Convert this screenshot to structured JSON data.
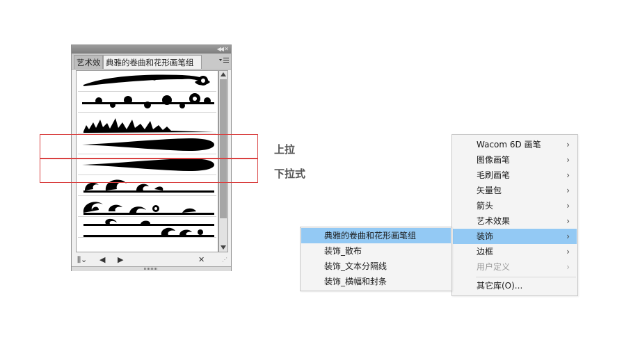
{
  "panel": {
    "tabs": [
      {
        "label": "艺术效"
      },
      {
        "label": "典雅的卷曲和花形画笔组"
      }
    ],
    "collapse_icon": "double-chevron-left-icon",
    "close_icon": "close-icon",
    "menu_icon": "panel-menu-icon",
    "brushes": [
      {
        "name": "curl-brush-1"
      },
      {
        "name": "curl-brush-2"
      },
      {
        "name": "flame-brush"
      },
      {
        "name": "taper-up-brush"
      },
      {
        "name": "taper-down-brush"
      },
      {
        "name": "wave-brush-1"
      },
      {
        "name": "wave-brush-2"
      },
      {
        "name": "wave-brush-3"
      }
    ],
    "bottom_icons": [
      "libraries-menu-icon",
      "previous-icon",
      "next-icon",
      "remove-brush-icon"
    ]
  },
  "callouts": {
    "upper": "上拉",
    "lower": "下拉式"
  },
  "main_menu": {
    "items": [
      {
        "label": "Wacom 6D 画笔",
        "has_submenu": true
      },
      {
        "label": "图像画笔",
        "has_submenu": true
      },
      {
        "label": "毛刷画笔",
        "has_submenu": true
      },
      {
        "label": "矢量包",
        "has_submenu": true
      },
      {
        "label": "箭头",
        "has_submenu": true
      },
      {
        "label": "艺术效果",
        "has_submenu": true
      },
      {
        "label": "装饰",
        "has_submenu": true,
        "highlighted": true
      },
      {
        "label": "边框",
        "has_submenu": true
      },
      {
        "label": "用户定义",
        "has_submenu": true,
        "disabled": true
      }
    ],
    "other_library": "其它库(O)..."
  },
  "sub_menu": {
    "items": [
      {
        "label": "典雅的卷曲和花形画笔组",
        "highlighted": true
      },
      {
        "label": "装饰_散布"
      },
      {
        "label": "装饰_文本分隔线"
      },
      {
        "label": "装饰_横幅和封条"
      }
    ]
  },
  "colors": {
    "highlight": "#93c9f4",
    "callout_border": "#d94040"
  }
}
